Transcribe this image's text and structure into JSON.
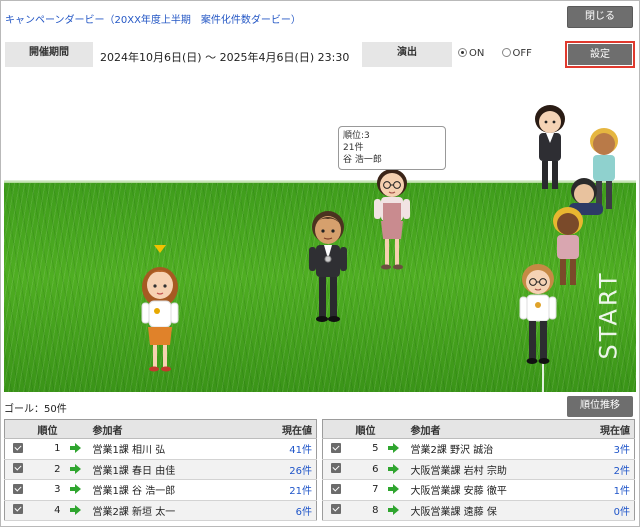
{
  "header": {
    "title": "キャンペーンダービー（20XX年度上半期　案件化件数ダービー）",
    "close_label": "閉じる"
  },
  "info": {
    "period_label": "開催期間",
    "period_value": "2024年10月6日(日) ～ 2025年4月6日(日) 23:30",
    "effect_label": "演出",
    "effect_options": [
      "ON",
      "OFF"
    ],
    "effect_selected": "ON",
    "settings_label": "設定"
  },
  "stage": {
    "tooltip": {
      "rank_line": "順位:3",
      "count_line": "21件",
      "name_line": "谷 浩一郎"
    },
    "start_text": "START"
  },
  "goal": {
    "text": "ゴール：50件",
    "history_label": "順位推移"
  },
  "table": {
    "headers": {
      "rank": "順位",
      "participant": "参加者",
      "current": "現在値"
    },
    "left": [
      {
        "rank": "1",
        "name": "営業1課 相川 弘",
        "value": "41件"
      },
      {
        "rank": "2",
        "name": "営業1課 春日 由佳",
        "value": "26件"
      },
      {
        "rank": "3",
        "name": "営業1課 谷 浩一郎",
        "value": "21件"
      },
      {
        "rank": "4",
        "name": "営業2課 新垣 太一",
        "value": "6件"
      }
    ],
    "right": [
      {
        "rank": "5",
        "name": "営業2課 野沢 誠治",
        "value": "3件"
      },
      {
        "rank": "6",
        "name": "大阪営業課 岩村 宗助",
        "value": "2件"
      },
      {
        "rank": "7",
        "name": "大阪営業課 安藤 徹平",
        "value": "1件"
      },
      {
        "rank": "8",
        "name": "大阪営業課 遠藤 保",
        "value": "0件"
      }
    ]
  },
  "colors": {
    "accent": "#2457c5",
    "button": "#6e6e6e",
    "highlight": "#e03a2e",
    "grass": "#4fae22",
    "arrow": "#2fa52f"
  }
}
